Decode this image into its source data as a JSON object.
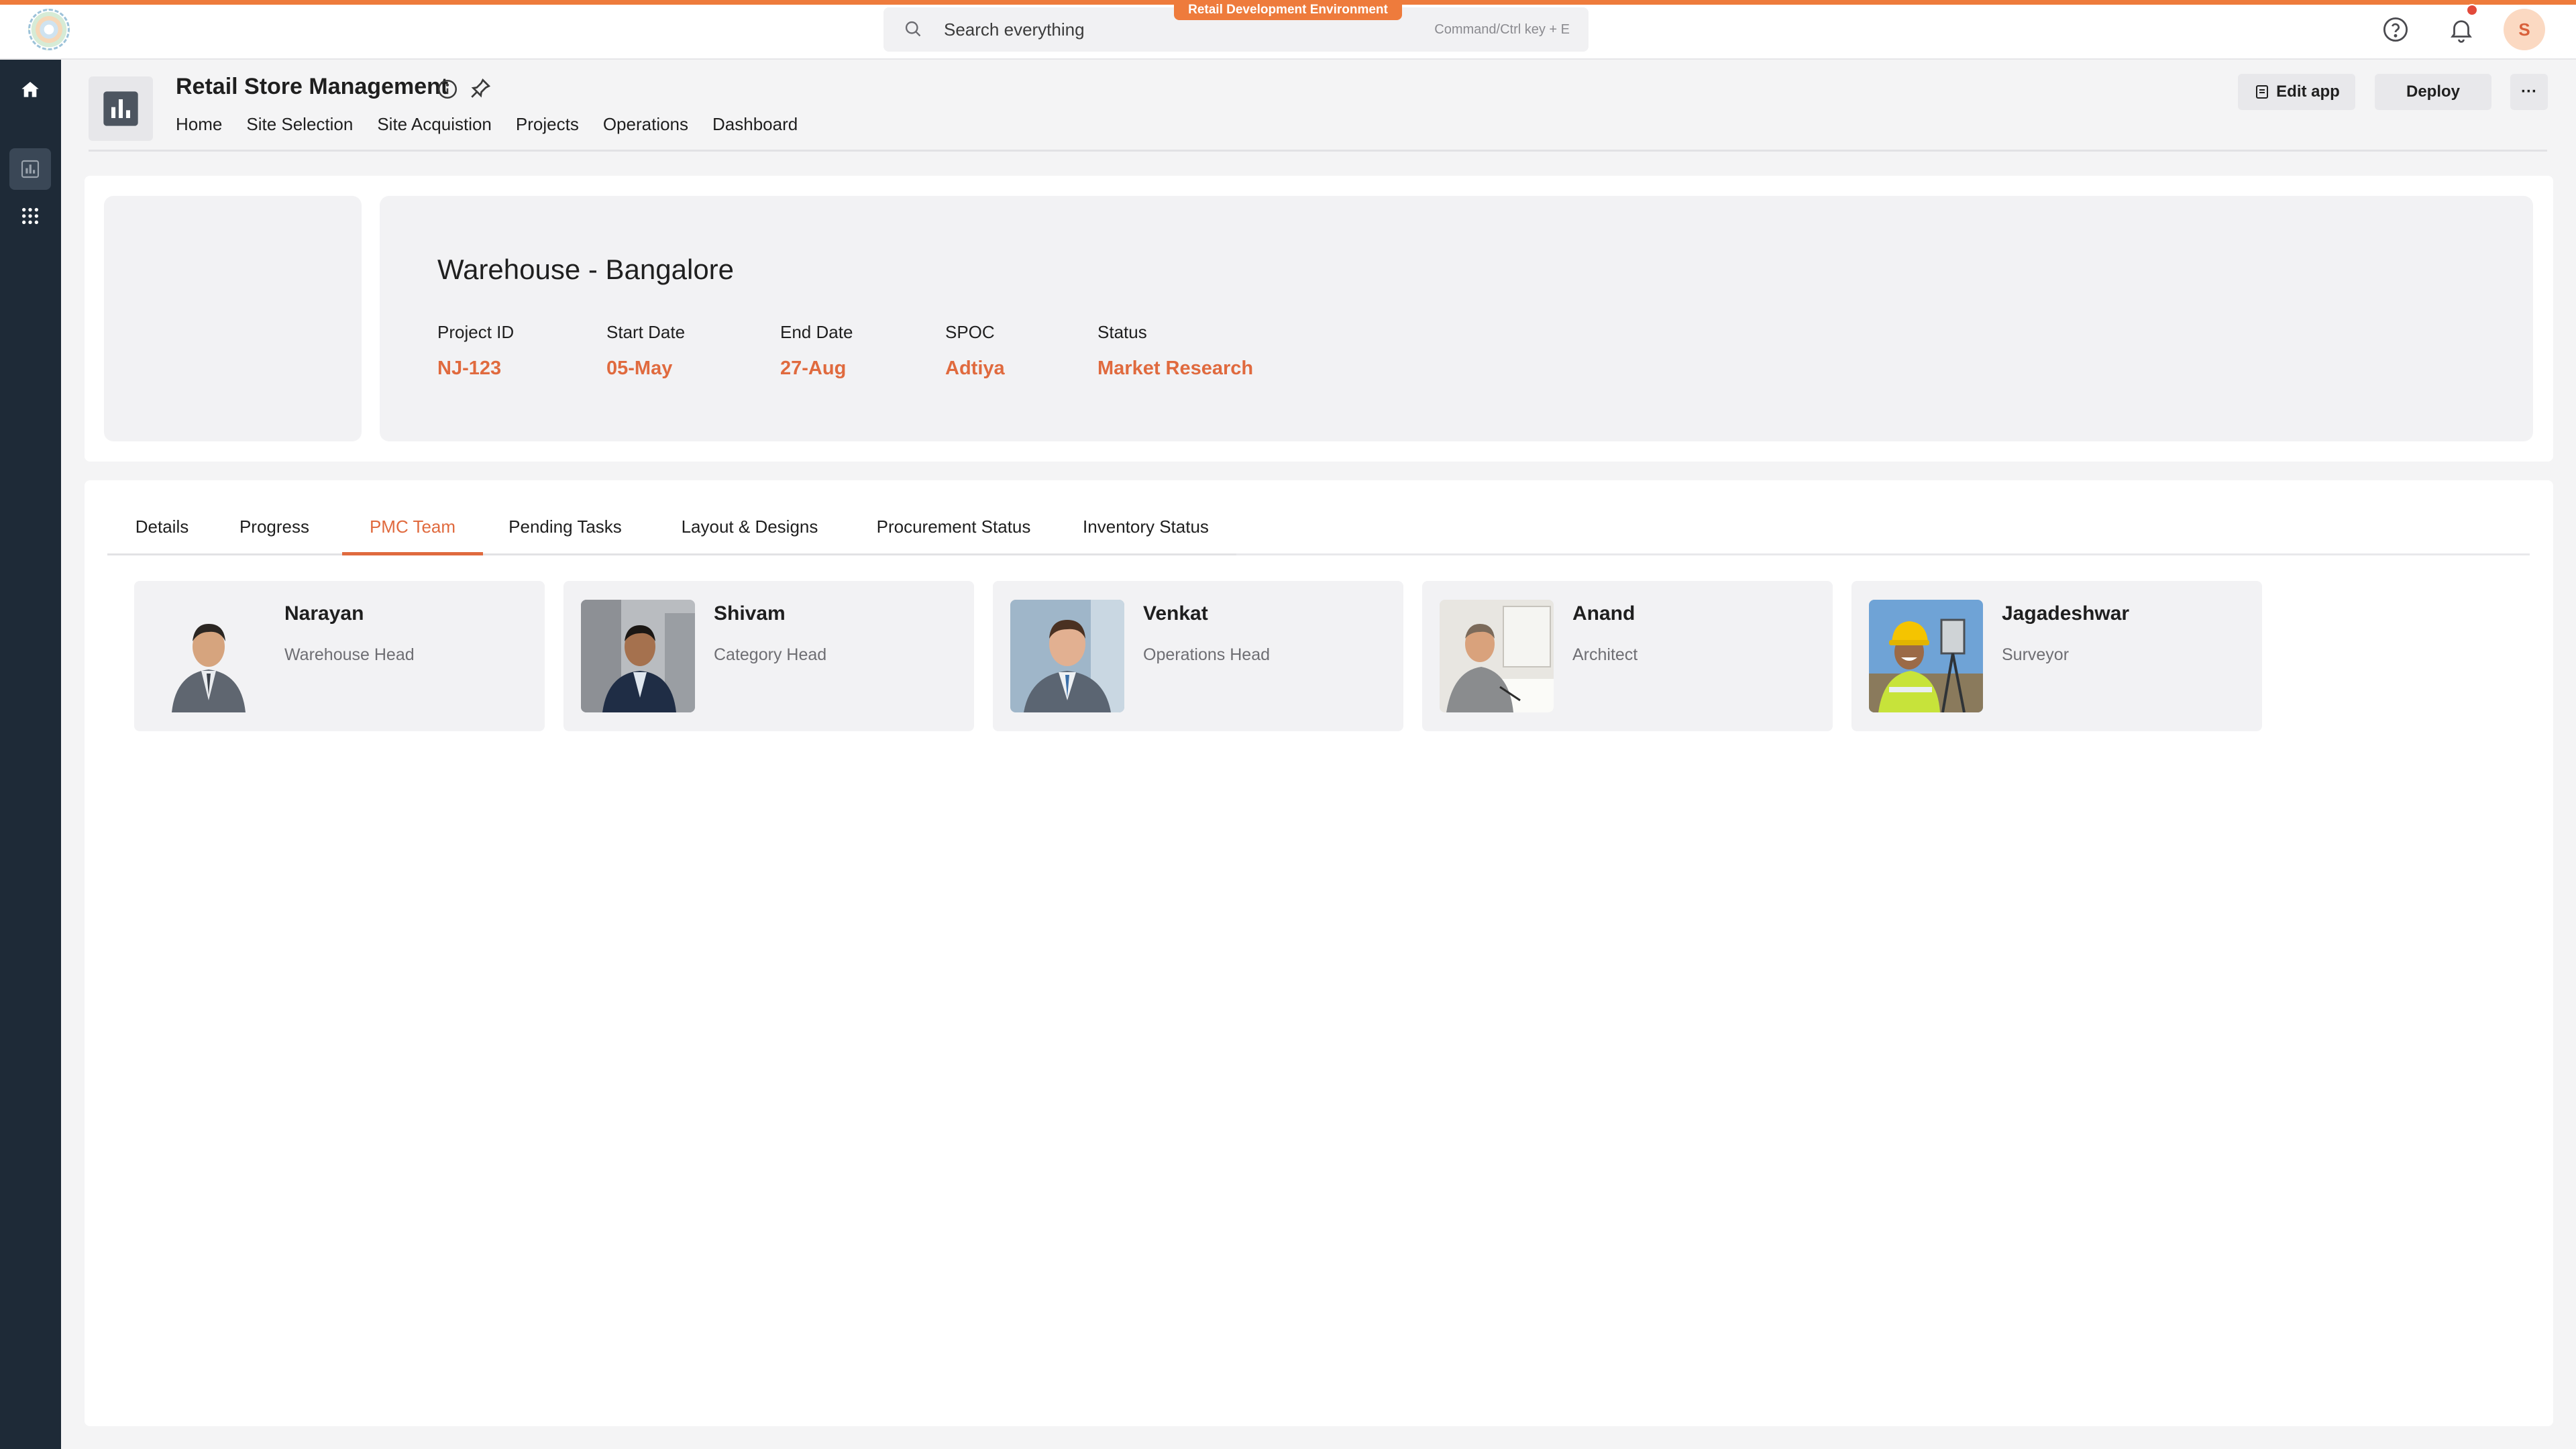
{
  "topbar": {
    "environment_label": "Retail Development Environment",
    "search_placeholder": "Search everything",
    "search_shortcut": "Command/Ctrl key + E",
    "avatar_initial": "S"
  },
  "colors": {
    "accent": "#ee7b3c",
    "value_text": "#e06a3e",
    "rail_bg": "#1e2a37"
  },
  "rail": {
    "items": [
      {
        "icon": "home-icon"
      },
      {
        "icon": "bar-chart-icon"
      },
      {
        "icon": "grid-apps-icon"
      }
    ]
  },
  "app": {
    "title": "Retail Store Management",
    "nav": [
      "Home",
      "Site Selection",
      "Site Acquistion",
      "Projects",
      "Operations",
      "Dashboard"
    ],
    "edit_label": "Edit app",
    "deploy_label": "Deploy",
    "more_label": "···"
  },
  "project": {
    "title": "Warehouse - Bangalore",
    "fields": [
      {
        "label": "Project ID",
        "value": "NJ-123"
      },
      {
        "label": "Start Date",
        "value": "05-May"
      },
      {
        "label": "End Date",
        "value": "27-Aug"
      },
      {
        "label": "SPOC",
        "value": "Adtiya"
      },
      {
        "label": "Status",
        "value": "Market Research"
      }
    ]
  },
  "tabs": {
    "items": [
      "Details",
      "Progress",
      "PMC Team",
      "Pending Tasks",
      "Layout & Designs",
      "Procurement Status",
      "Inventory Status"
    ],
    "active": "PMC Team"
  },
  "team": [
    {
      "name": "Narayan",
      "role": "Warehouse Head"
    },
    {
      "name": "Shivam",
      "role": "Category Head"
    },
    {
      "name": "Venkat",
      "role": "Operations Head"
    },
    {
      "name": "Anand",
      "role": "Architect"
    },
    {
      "name": "Jagadeshwar",
      "role": "Surveyor"
    }
  ]
}
